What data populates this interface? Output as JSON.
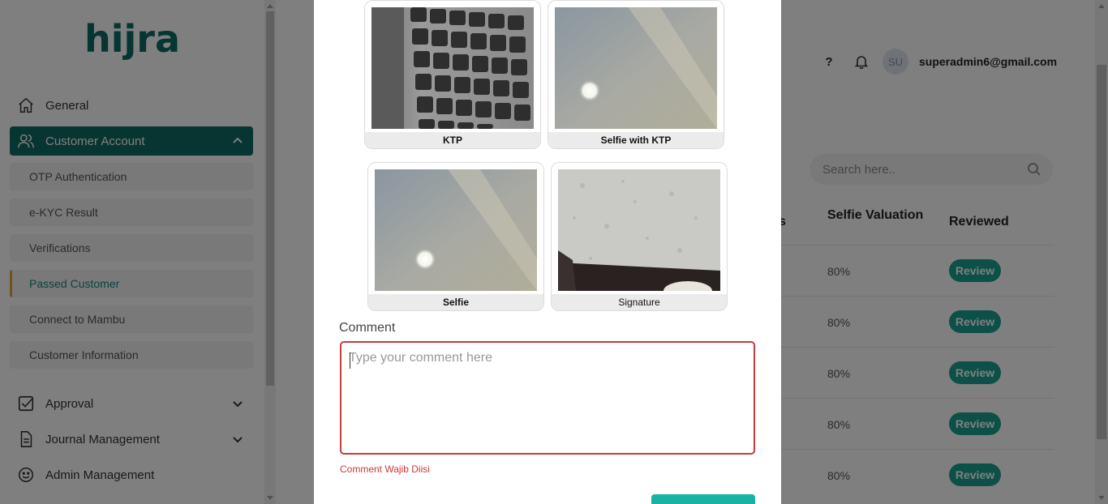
{
  "brand": {
    "logo_text": "hijra"
  },
  "sidebar": {
    "items": [
      {
        "label": "General",
        "icon": "home-icon"
      },
      {
        "label": "Customer Account",
        "icon": "users-icon"
      },
      {
        "label": "Approval",
        "icon": "check-square-icon"
      },
      {
        "label": "Journal Management",
        "icon": "document-icon"
      },
      {
        "label": "Admin Management",
        "icon": "smile-icon"
      }
    ],
    "sub_items": [
      {
        "label": "OTP Authentication"
      },
      {
        "label": "e-KYC Result"
      },
      {
        "label": "Verifications"
      },
      {
        "label": "Passed Customer"
      },
      {
        "label": "Connect to Mambu"
      },
      {
        "label": "Customer Information"
      }
    ]
  },
  "header": {
    "help": "?",
    "avatar_initials": "SU",
    "user_email": "superadmin6@gmail.com"
  },
  "search": {
    "placeholder": "Search here.."
  },
  "table": {
    "columns": [
      "s",
      "Selfie Valuation",
      "Reviewed"
    ],
    "rows": [
      {
        "selfie_valuation": "80%",
        "action": "Review"
      },
      {
        "selfie_valuation": "80%",
        "action": "Review"
      },
      {
        "selfie_valuation": "80%",
        "action": "Review"
      },
      {
        "selfie_valuation": "80%",
        "action": "Review"
      },
      {
        "selfie_valuation": "80%",
        "action": "Review"
      }
    ]
  },
  "modal": {
    "photos": [
      {
        "caption": "KTP"
      },
      {
        "caption": "Selfie with KTP"
      },
      {
        "caption": "Selfie"
      },
      {
        "caption": "Signature"
      }
    ],
    "comment_label": "Comment",
    "comment_value": "",
    "comment_placeholder": "Type your comment here",
    "error_text": "Comment Wajib Diisi"
  },
  "colors": {
    "brand": "#0f6b64",
    "accent": "#1ab3a3",
    "error": "#c93a3a",
    "active_indicator": "#e8a33a"
  }
}
